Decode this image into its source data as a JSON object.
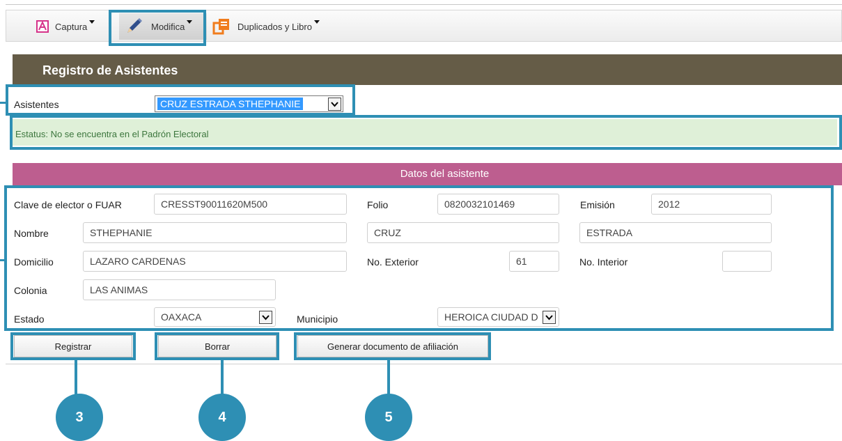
{
  "toolbar": {
    "captura": "Captura",
    "modifica": "Modifica",
    "duplicados": "Duplicados y Libro"
  },
  "header": {
    "title": "Registro de Asistentes"
  },
  "asistentes": {
    "label": "Asistentes",
    "selected": "CRUZ ESTRADA STHEPHANIE"
  },
  "status": {
    "text": "Estatus: No se encuentra en el Padrón Electoral"
  },
  "section": {
    "title": "Datos del asistente"
  },
  "form": {
    "clave_label": "Clave de elector o  FUAR",
    "clave_value": "CRESST90011620M500",
    "folio_label": "Folio",
    "folio_value": "0820032101469",
    "emision_label": "Emisión",
    "emision_value": "2012",
    "nombre_label": "Nombre",
    "nombre_value": "STHEPHANIE",
    "paterno_value": "CRUZ",
    "materno_value": "ESTRADA",
    "domicilio_label": "Domicilio",
    "domicilio_value": "LAZARO CARDENAS",
    "exterior_label": "No. Exterior",
    "exterior_value": "61",
    "interior_label": "No. Interior",
    "interior_value": "",
    "colonia_label": "Colonia",
    "colonia_value": "LAS ANIMAS",
    "estado_label": "Estado",
    "estado_value": "OAXACA",
    "municipio_label": "Municipio",
    "municipio_value": "HEROICA CIUDAD D"
  },
  "buttons": {
    "registrar": "Registrar",
    "borrar": "Borrar",
    "generar": "Generar documento de afiliación"
  },
  "callouts": {
    "c3": "3",
    "c4": "4",
    "c5": "5"
  },
  "colors": {
    "accent": "#2e8fb4",
    "header_bg": "#655c47",
    "section_bg": "#bd5e8f",
    "status_bg": "#dff0d8",
    "status_text": "#3c763d"
  }
}
